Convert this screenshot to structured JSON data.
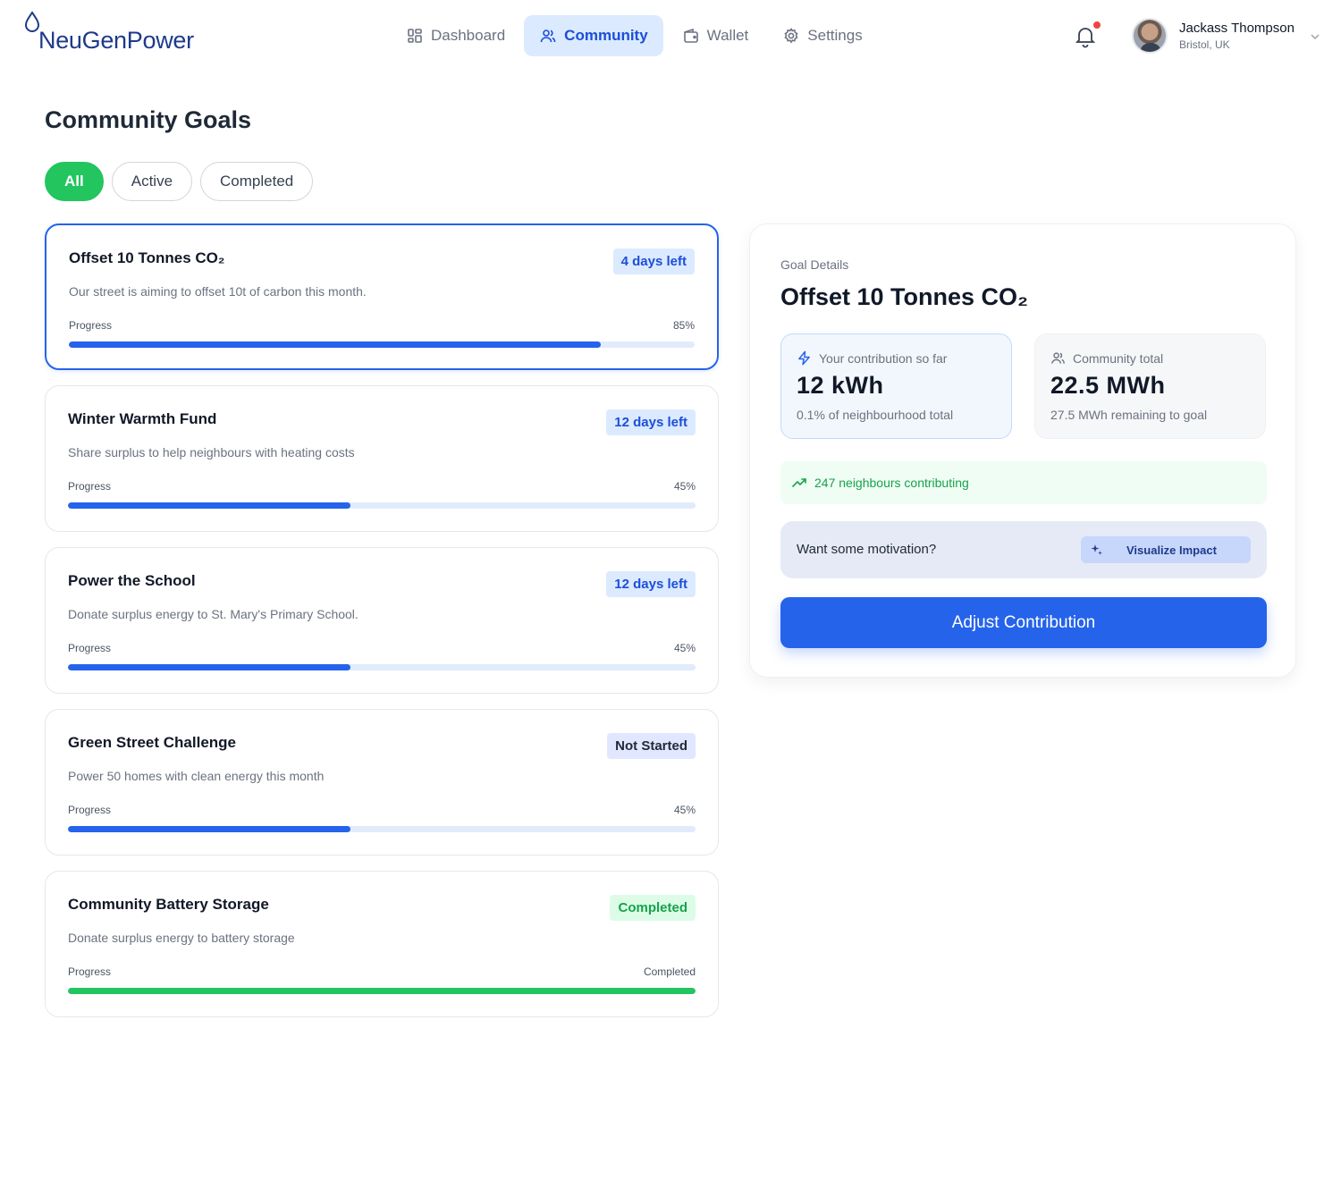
{
  "app": {
    "brand": "NeuGenPower"
  },
  "nav": {
    "items": [
      {
        "label": "Dashboard",
        "icon": "dashboard-icon",
        "active": false
      },
      {
        "label": "Community",
        "icon": "users-icon",
        "active": true
      },
      {
        "label": "Wallet",
        "icon": "wallet-icon",
        "active": false
      },
      {
        "label": "Settings",
        "icon": "gear-icon",
        "active": false
      }
    ]
  },
  "user": {
    "name": "Jackass Thompson",
    "location": "Bristol, UK",
    "has_notification": true
  },
  "page": {
    "title": "Community Goals"
  },
  "filters": [
    {
      "label": "All",
      "active": true
    },
    {
      "label": "Active",
      "active": false
    },
    {
      "label": "Completed",
      "active": false
    }
  ],
  "goals": [
    {
      "title": "Offset 10 Tonnes CO₂",
      "badge": "4 days left",
      "badge_type": "days",
      "description": "Our street is aiming to offset 10t of carbon this month.",
      "progress_label": "Progress",
      "progress_value": "85%",
      "progress": 85,
      "selected": true
    },
    {
      "title": "Winter Warmth Fund",
      "badge": "12 days left",
      "badge_type": "days",
      "description": "Share surplus to help neighbours with heating costs",
      "progress_label": "Progress",
      "progress_value": "45%",
      "progress": 45,
      "selected": false
    },
    {
      "title": "Power the School",
      "badge": "12 days left",
      "badge_type": "days",
      "description": "Donate surplus energy to St. Mary's Primary School.",
      "progress_label": "Progress",
      "progress_value": "45%",
      "progress": 45,
      "selected": false
    },
    {
      "title": "Green Street Challenge",
      "badge": "Not Started",
      "badge_type": "notstarted",
      "description": "Power 50 homes with clean energy this month",
      "progress_label": "Progress",
      "progress_value": "45%",
      "progress": 45,
      "selected": false
    },
    {
      "title": "Community Battery Storage",
      "badge": "Completed",
      "badge_type": "completed",
      "description": "Donate surplus energy to battery storage",
      "progress_label": "Progress",
      "progress_value": "Completed",
      "progress": 100,
      "selected": false
    }
  ],
  "details": {
    "label": "Goal Details",
    "title": "Offset 10 Tonnes CO₂",
    "your_contribution": {
      "label": "Your contribution so far",
      "value": "12 kWh",
      "sub": "0.1% of neighbourhood total"
    },
    "community_total": {
      "label": "Community total",
      "value": "22.5 MWh",
      "sub": "27.5 MWh remaining to goal"
    },
    "contributors": "247 neighbours contributing",
    "motivation": {
      "text": "Want some motivation?",
      "button": "Visualize Impact"
    },
    "adjust_button": "Adjust Contribution"
  },
  "colors": {
    "primary": "#2563eb",
    "success": "#22c55e",
    "brand": "#1e3a8a",
    "alert": "#ef4444"
  }
}
